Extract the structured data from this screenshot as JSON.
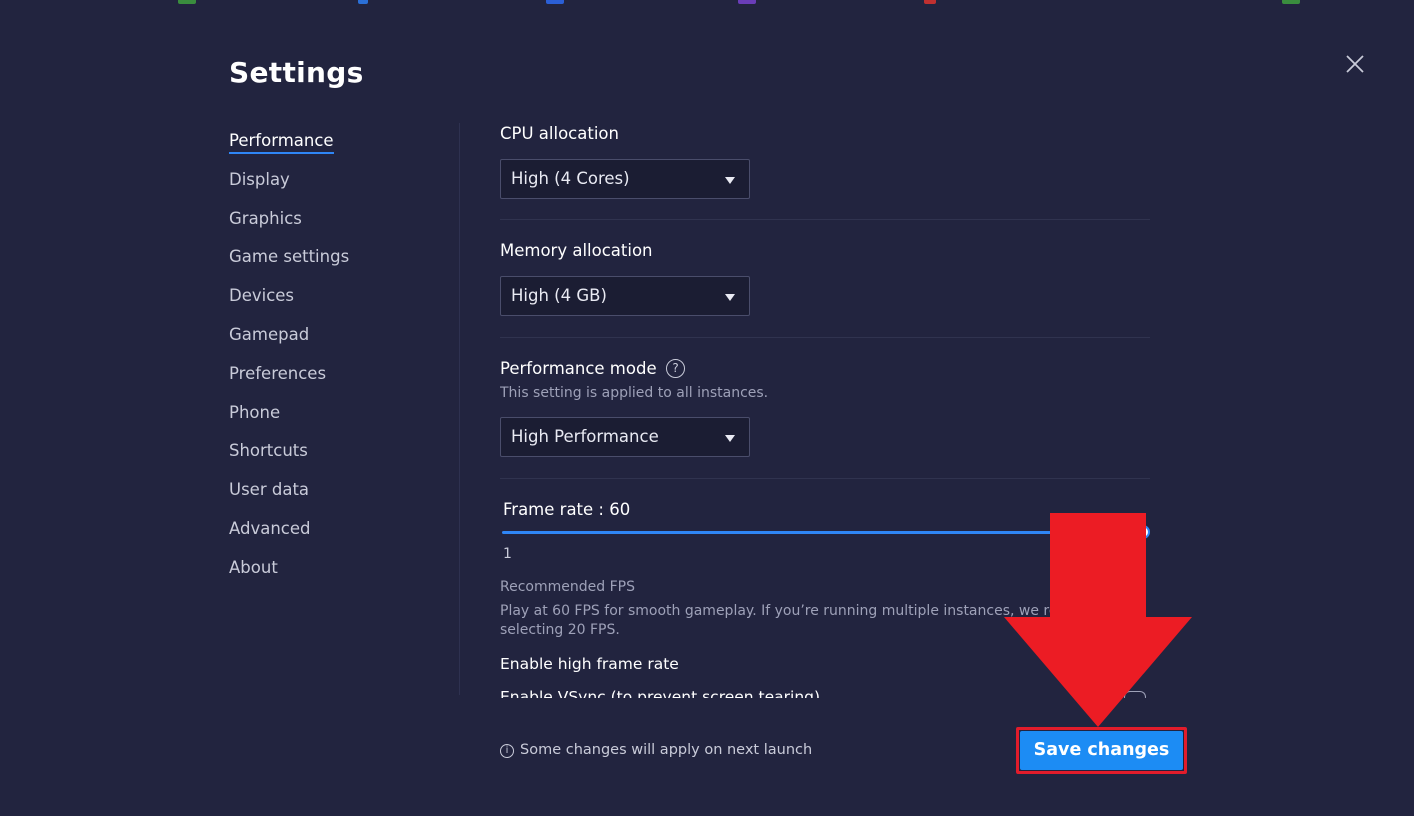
{
  "settings": {
    "title": "Settings",
    "nav": [
      {
        "label": "Performance",
        "active": true
      },
      {
        "label": "Display"
      },
      {
        "label": "Graphics"
      },
      {
        "label": "Game settings"
      },
      {
        "label": "Devices"
      },
      {
        "label": "Gamepad"
      },
      {
        "label": "Preferences"
      },
      {
        "label": "Phone"
      },
      {
        "label": "Shortcuts"
      },
      {
        "label": "User data"
      },
      {
        "label": "Advanced"
      },
      {
        "label": "About"
      }
    ]
  },
  "performance": {
    "cpu_label": "CPU allocation",
    "cpu_value": "High (4 Cores)",
    "memory_label": "Memory allocation",
    "memory_value": "High (4 GB)",
    "mode_label": "Performance mode",
    "mode_note": "This setting is applied to all instances.",
    "mode_value": "High Performance",
    "frame_rate_label": "Frame rate : 60",
    "frame_rate_min": "1",
    "frame_rate_fraction": 1.0,
    "recommended_title": "Recommended FPS",
    "recommended_line1": "Play at 60 FPS for smooth gameplay. If you’re running multiple instances, we re",
    "recommended_line2": "selecting 20 FPS.",
    "high_frame_rate_label": "Enable high frame rate",
    "vsync_label": "Enable VSync (to prevent screen tearing)"
  },
  "footer": {
    "note": "Some changes will apply on next launch",
    "save_label": "Save changes"
  },
  "colors": {
    "background": "#22243f",
    "accent": "#1c8cf4",
    "annotation_red": "#e21c2b"
  }
}
